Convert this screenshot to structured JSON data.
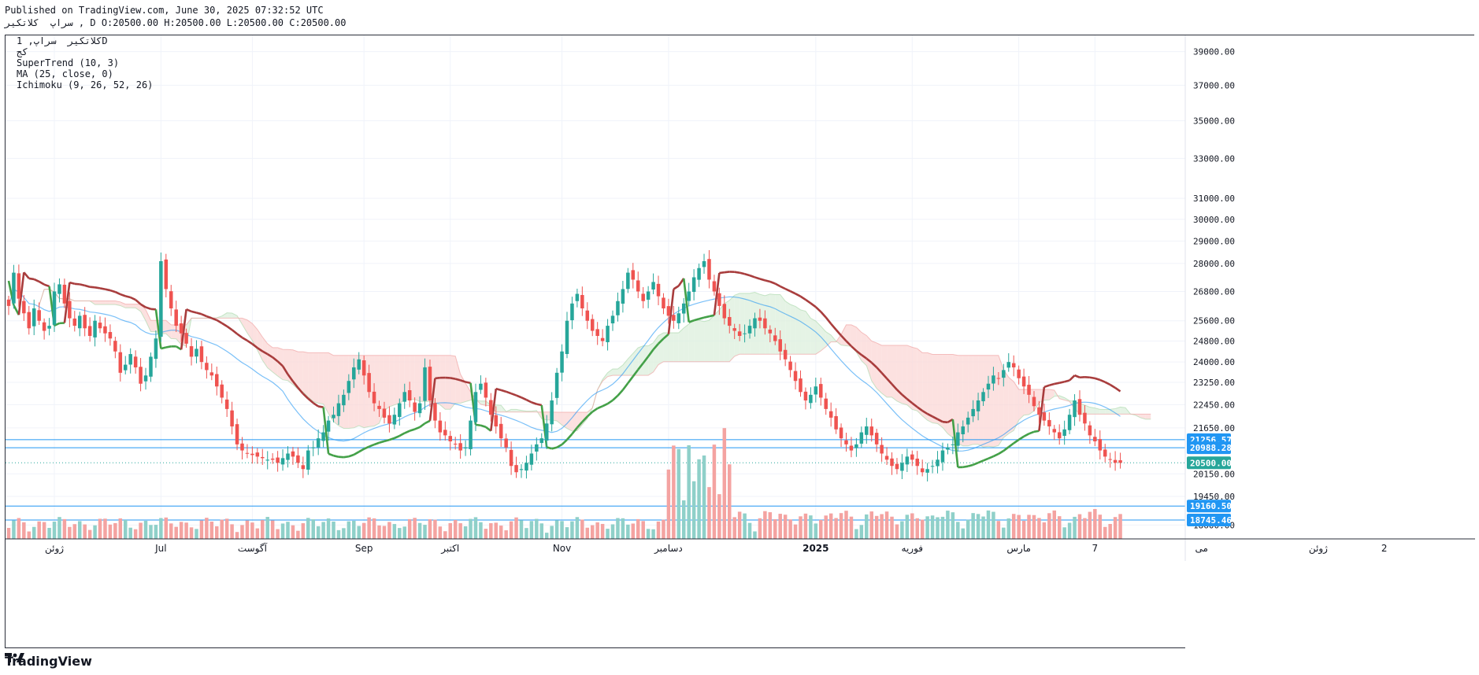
{
  "header": {
    "published": "Published on TradingView.com, June 30, 2025 07:32:52 UTC",
    "ohlc": "سراپ  کلاتکیر , D O:20500.00 H:20500.00 L:20500.00 C:20500.00"
  },
  "legend": {
    "symbol": "کلاتکیر  سراپ, 1D",
    "market": "کج",
    "supertrend": "SuperTrend (10, 3)",
    "ma": "MA (25, close, 0)",
    "ichimoku": "Ichimoku (9, 26, 52, 26)"
  },
  "brand": {
    "name": "TradingView",
    "logo_icon": "tradingview-logo-icon"
  },
  "colors": {
    "up": "#26a69a",
    "down": "#ef5350",
    "up_volume": "#8fd0c9",
    "down_volume": "#f4a3a1",
    "supertrend_up": "#43a047",
    "supertrend_down": "#a83c3c",
    "ma": "#2196f3",
    "cloud_bear": "#fbd7d5",
    "cloud_bull": "#dcefdc",
    "hline": "#2196f3",
    "price_tag": "#26a69a",
    "tag_blue": "#2196f3"
  },
  "chart_data": {
    "type": "candlestick",
    "scale": "log",
    "y_ticks": [
      39000,
      37000,
      35000,
      33000,
      31000,
      30000,
      29000,
      28000,
      26800,
      25600,
      24800,
      24000,
      23250,
      22450,
      21650,
      20150,
      19450,
      18600
    ],
    "x_ticks": [
      {
        "label": "ژوئن",
        "i": 9
      },
      {
        "label": "Jul",
        "i": 30
      },
      {
        "label": "آگوست",
        "i": 48
      },
      {
        "label": "Sep",
        "i": 70
      },
      {
        "label": "اکتبر",
        "i": 87
      },
      {
        "label": "Nov",
        "i": 109
      },
      {
        "label": "دسامبر",
        "i": 130
      },
      {
        "label": "2025",
        "i": 159
      },
      {
        "label": "فوریه",
        "i": 178
      },
      {
        "label": "مارس",
        "i": 199
      },
      {
        "label": "7",
        "i": 214
      },
      {
        "label": "می",
        "i": 235
      },
      {
        "label": "ژوئن",
        "i": 258
      },
      {
        "label": "2",
        "i": 271
      }
    ],
    "price_lines": [
      {
        "value": 21256.57,
        "label": "21256.57",
        "style": "solid",
        "tag": "blue"
      },
      {
        "value": 20988.28,
        "label": "20988.28",
        "style": "solid",
        "tag": "blue"
      },
      {
        "value": 20500.0,
        "label": "20500.00",
        "style": "dotted",
        "tag": "green"
      },
      {
        "value": 19160.5,
        "label": "19160.50",
        "style": "solid",
        "tag": "blue"
      },
      {
        "value": 18745.46,
        "label": "18745.46",
        "style": "solid",
        "tag": "blue"
      }
    ],
    "closes": [
      26200,
      27600,
      26500,
      25900,
      25300,
      26100,
      25600,
      25200,
      25400,
      26800,
      27100,
      26300,
      25700,
      25400,
      25800,
      25300,
      25000,
      25600,
      25300,
      25100,
      24900,
      24400,
      23600,
      23900,
      24300,
      23800,
      23200,
      23500,
      24200,
      24900,
      28100,
      26900,
      26100,
      25400,
      25100,
      24700,
      24200,
      24500,
      24000,
      23700,
      23500,
      23100,
      22700,
      22300,
      21700,
      21100,
      20900,
      20800,
      20750,
      20700,
      20650,
      20600,
      20600,
      20500,
      20650,
      20800,
      20700,
      20500,
      20300,
      20900,
      21000,
      21300,
      21500,
      21900,
      22100,
      22500,
      22800,
      23300,
      23800,
      24100,
      23500,
      22900,
      22500,
      22300,
      22000,
      21800,
      22100,
      22500,
      22900,
      22600,
      22200,
      22500,
      23800,
      22600,
      21900,
      21500,
      21400,
      21200,
      21100,
      20900,
      21000,
      21900,
      22900,
      23200,
      22700,
      22100,
      21700,
      21300,
      21000,
      20400,
      20200,
      20300,
      20500,
      20800,
      21100,
      21300,
      21800,
      22600,
      23600,
      24400,
      25600,
      26300,
      26700,
      26100,
      25600,
      25200,
      25000,
      24800,
      25400,
      25800,
      26400,
      26900,
      27600,
      27300,
      26800,
      26400,
      26800,
      27200,
      26600,
      26100,
      25800,
      25600,
      25900,
      26300,
      26800,
      27400,
      27800,
      28100,
      27300,
      26800,
      26200,
      25700,
      25400,
      25200,
      25000,
      25100,
      25400,
      25700,
      25600,
      25300,
      25100,
      24800,
      24400,
      24100,
      23700,
      23300,
      22900,
      22600,
      22800,
      23100,
      22700,
      22300,
      22000,
      21600,
      21300,
      21100,
      20900,
      21100,
      21500,
      21700,
      21400,
      21100,
      20800,
      20600,
      20400,
      20300,
      20500,
      20700,
      20600,
      20400,
      20200,
      20300,
      20400,
      20600,
      20900,
      21000,
      21100,
      21500,
      21700,
      22000,
      22300,
      22600,
      22900,
      23200,
      23500,
      23400,
      23700,
      24000,
      23800,
      23400,
      23100,
      22800,
      22400,
      22100,
      21900,
      21700,
      21500,
      21300,
      21600,
      22100,
      22600,
      22100,
      21800,
      21400,
      21200,
      20900,
      20700,
      20600,
      20500,
      20500
    ]
  }
}
